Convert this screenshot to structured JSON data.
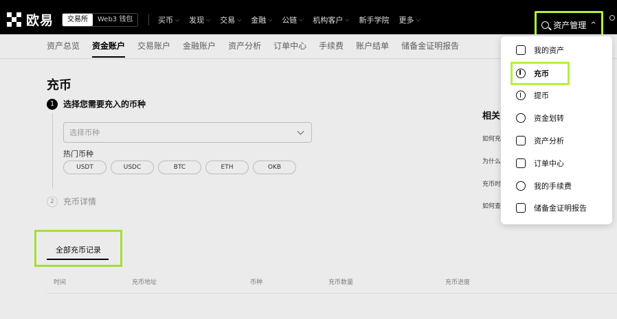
{
  "brand": {
    "name": "欧易"
  },
  "mode_switch": {
    "exchange": "交易所",
    "web3": "Web3 钱包"
  },
  "nav": [
    {
      "label": "买币",
      "chevron": true
    },
    {
      "label": "发现",
      "chevron": true
    },
    {
      "label": "交易",
      "chevron": true
    },
    {
      "label": "金融",
      "chevron": true
    },
    {
      "label": "公链",
      "chevron": true
    },
    {
      "label": "机构客户",
      "chevron": true
    },
    {
      "label": "新手学院",
      "chevron": false
    },
    {
      "label": "更多",
      "chevron": true
    }
  ],
  "asset_button": {
    "label": "资产管理",
    "caret": "^"
  },
  "subnav": [
    {
      "label": "资产总览",
      "active": false
    },
    {
      "label": "资金账户",
      "active": true
    },
    {
      "label": "交易账户",
      "active": false
    },
    {
      "label": "金融账户",
      "active": false
    },
    {
      "label": "资产分析",
      "active": false
    },
    {
      "label": "订单中心",
      "active": false
    },
    {
      "label": "手续费",
      "active": false
    },
    {
      "label": "账户结单",
      "active": false
    },
    {
      "label": "储备金证明报告",
      "active": false
    }
  ],
  "page_title": "充币",
  "step1": {
    "num": "1",
    "title": "选择您需要充入的币种"
  },
  "coin_select": {
    "placeholder": "选择币种"
  },
  "hot_label": "热门币种",
  "hot_coins": [
    "USDT",
    "USDC",
    "BTC",
    "ETH",
    "OKB"
  ],
  "step2": {
    "num": "2",
    "title": "充币详情"
  },
  "records_tab": {
    "label": "全部充币记录"
  },
  "table_headers": [
    "时间",
    "充币地址",
    "币种",
    "充币数量",
    "充币进度"
  ],
  "faq": {
    "title": "相关",
    "items": [
      "如何充",
      "为什么",
      "充币时",
      "如何查"
    ]
  },
  "dropdown": [
    {
      "label": "我的资产",
      "icon": "wallet-icon"
    },
    {
      "label": "充币",
      "icon": "deposit-icon"
    },
    {
      "label": "提币",
      "icon": "withdraw-icon"
    },
    {
      "label": "资金划转",
      "icon": "transfer-icon"
    },
    {
      "label": "资产分析",
      "icon": "analysis-icon"
    },
    {
      "label": "订单中心",
      "icon": "order-icon"
    },
    {
      "label": "我的手续费",
      "icon": "fee-icon"
    },
    {
      "label": "储备金证明报告",
      "icon": "report-icon"
    }
  ],
  "colors": {
    "highlight": "#b4f03c",
    "topbar": "#000000"
  }
}
